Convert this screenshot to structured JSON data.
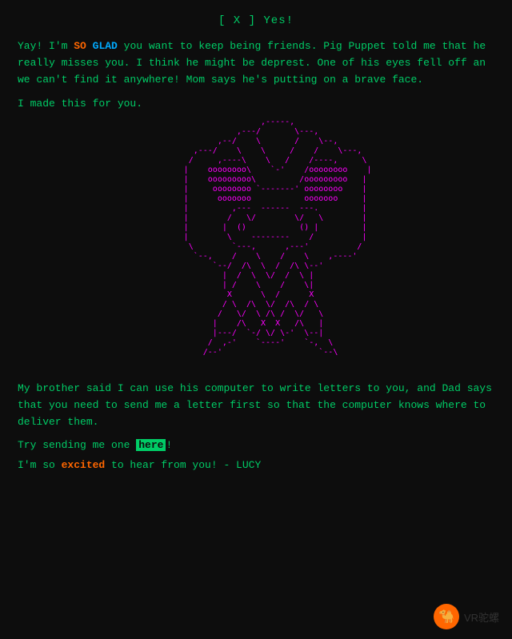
{
  "header": {
    "title": "[ X ] Yes!"
  },
  "paragraph1": {
    "text_before": "Yay! I'm ",
    "so": "SO",
    "space": " ",
    "glad": "GLAD",
    "text_after": " you want to keep being friends. Pig Puppet told me that he really misses you. I think he might be deprest. One of his eyes fell off an we can't find it anywhere! Mom says he's putting on a brave face."
  },
  "paragraph2": {
    "text": "I made this for you."
  },
  "paragraph3": {
    "text": "My brother said I can use his computer to write letters to you, and Dad says that you need to send me a letter first so that the computer knows where to deliver them."
  },
  "paragraph4": {
    "text_before": "Try sending me one ",
    "here": "here",
    "text_after": "!"
  },
  "signature": {
    "text_before": "I'm so ",
    "excited": "excited",
    "text_after": " to hear from you! - LUCY"
  },
  "watermark": {
    "label": "VR驼螺"
  },
  "ascii_art": "                    ,----.\n               ,---'      `---.\n          ,---'    /`-.    /   `---.\n     ,---'        /    `-./        `---.\n    /             |  ()  ()            \\\n   |    oooooooo  |                     |\n   |    oooooooo  |     ----------      |\n   |     ooooooo  |                     |\n   |      oooooo  |   ()    ()          |\n   |              |     ----------      |\n    \\             |                    /\n     `---.,       |              ,----'\n          `---.,  |         ,---'\n               `--+--------'\n              /              \\\n             /    /\\    /\\    \\\n            |    /  \\  /  \\   |\n            |   /    \\/    \\  |\n             \\ /      /\\    \\ /\n              X      /  \\    X\n             / \\    /    \\  / \\\n            /   \\--/      \\/   \\"
}
